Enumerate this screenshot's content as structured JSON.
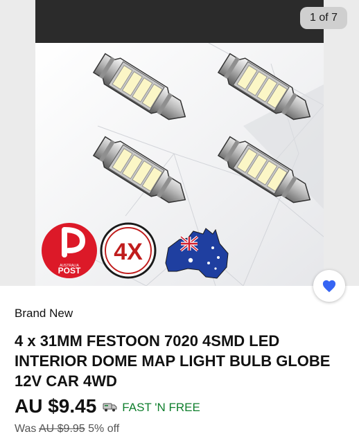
{
  "gallery": {
    "counter": "1 of 7",
    "badge_brand": "POST",
    "badge_brand_small": "AUSTRALIA",
    "badge_qty": "4X"
  },
  "listing": {
    "condition": "Brand New",
    "title": "4 x 31MM FESTOON 7020 4SMD LED INTERIOR DOME MAP LIGHT BULB GLOBE 12V CAR 4WD",
    "price": "AU $9.45",
    "shipping": "FAST 'N FREE",
    "was_label": "Was",
    "was_price": "AU $9.95",
    "discount": "5% off"
  },
  "colors": {
    "shipping_green": "#0e7e2c",
    "favorite_blue": "#3665f3",
    "post_red": "#dc1928"
  }
}
